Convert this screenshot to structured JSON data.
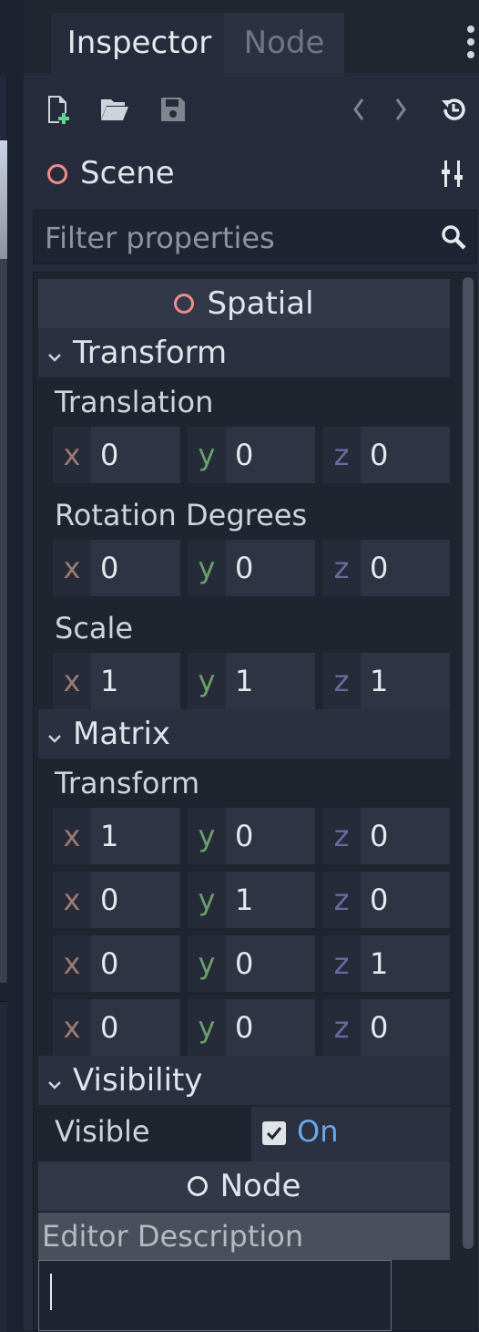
{
  "tabs": [
    {
      "label": "Inspector",
      "active": true
    },
    {
      "label": "Node",
      "active": false
    }
  ],
  "toolbar": {
    "icons": [
      "new-resource-icon",
      "open-folder-icon",
      "save-icon",
      "history-back-icon",
      "history-forward-icon",
      "object-history-icon"
    ]
  },
  "scene": {
    "label": "Scene",
    "icon": "spatial-ring-icon",
    "tools_icon": "object-properties-icon"
  },
  "filter": {
    "placeholder": "Filter properties",
    "icon": "search-icon"
  },
  "spatial": {
    "title": "Spatial",
    "transform_section": "Transform",
    "translation_label": "Translation",
    "translation": {
      "x": "0",
      "y": "0",
      "z": "0"
    },
    "rotation_label": "Rotation Degrees",
    "rotation": {
      "x": "0",
      "y": "0",
      "z": "0"
    },
    "scale_label": "Scale",
    "scale": {
      "x": "1",
      "y": "1",
      "z": "1"
    },
    "matrix_section": "Matrix",
    "matrix_label": "Transform",
    "matrix_rows": [
      {
        "x": "1",
        "y": "0",
        "z": "0"
      },
      {
        "x": "0",
        "y": "1",
        "z": "0"
      },
      {
        "x": "0",
        "y": "0",
        "z": "1"
      },
      {
        "x": "0",
        "y": "0",
        "z": "0"
      }
    ],
    "visibility_section": "Visibility",
    "visible_label": "Visible",
    "visible_value": "On"
  },
  "node": {
    "title": "Node",
    "editor_description_label": "Editor Description",
    "editor_description_value": ""
  },
  "axis_labels": {
    "x": "x",
    "y": "y",
    "z": "z"
  },
  "colors": {
    "accent_on": "#6aa8ec",
    "spatial_ring": "#f08c8c",
    "axis_x": "#9c7c72",
    "axis_y": "#6ba06a",
    "axis_z": "#6a6a9e"
  }
}
